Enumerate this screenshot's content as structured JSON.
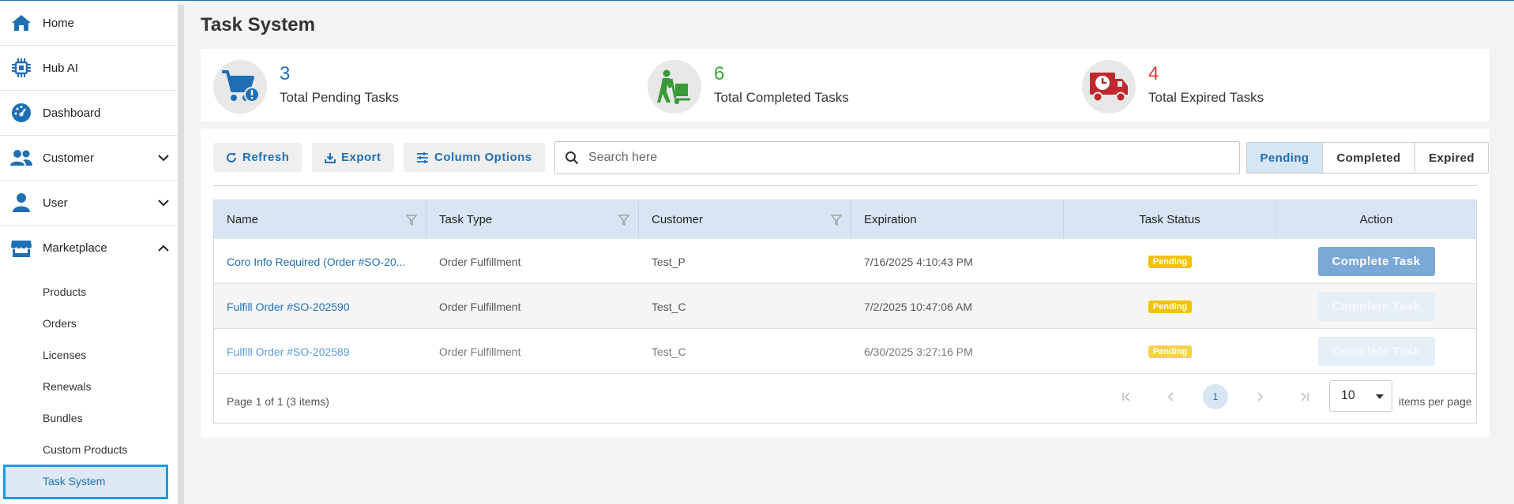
{
  "sidebar": {
    "items": [
      {
        "label": "Home",
        "icon": "home-icon"
      },
      {
        "label": "Hub AI",
        "icon": "chip-icon"
      },
      {
        "label": "Dashboard",
        "icon": "gauge-icon"
      },
      {
        "label": "Customer",
        "icon": "users-icon"
      },
      {
        "label": "User",
        "icon": "user-icon"
      },
      {
        "label": "Marketplace",
        "icon": "store-icon"
      }
    ],
    "marketplace_sub": [
      "Products",
      "Orders",
      "Licenses",
      "Renewals",
      "Bundles",
      "Custom Products",
      "Task System"
    ],
    "active_sub": "Task System"
  },
  "page": {
    "title": "Task System"
  },
  "stats": [
    {
      "value": "3",
      "caption": "Total Pending Tasks",
      "color": "#1f6fb5",
      "icon": "cart-alert-icon"
    },
    {
      "value": "6",
      "caption": "Total Completed Tasks",
      "color": "#3aa53a",
      "icon": "dolly-icon"
    },
    {
      "value": "4",
      "caption": "Total Expired Tasks",
      "color": "#d93a3a",
      "icon": "truck-clock-icon"
    }
  ],
  "toolbar": {
    "refresh": "Refresh",
    "export": "Export",
    "column_options": "Column Options",
    "search_placeholder": "Search here",
    "filters": [
      "Pending",
      "Completed",
      "Expired"
    ],
    "active_filter": "Pending"
  },
  "table": {
    "headers": [
      "Name",
      "Task Type",
      "Customer",
      "Expiration",
      "Task Status",
      "Action"
    ],
    "rows": [
      {
        "name": "Coro Info Required (Order #SO-20...",
        "type": "Order Fulfillment",
        "customer": "Test_P",
        "expiration": "7/16/2025 4:10:43 PM",
        "status": "Pending",
        "action": "Complete Task"
      },
      {
        "name": "Fulfill Order #SO-202590",
        "type": "Order Fulfillment",
        "customer": "Test_C",
        "expiration": "7/2/2025 10:47:06 AM",
        "status": "Pending",
        "action": "Complete Task"
      },
      {
        "name": "Fulfill Order #SO-202589",
        "type": "Order Fulfillment",
        "customer": "Test_C",
        "expiration": "6/30/2025 3:27:16 PM",
        "status": "Pending",
        "action": "Complete Task"
      }
    ]
  },
  "pager": {
    "summary": "Page 1 of 1 (3 items)",
    "current_page": "1",
    "page_size": "10",
    "items_per_page_label": "items per page"
  }
}
